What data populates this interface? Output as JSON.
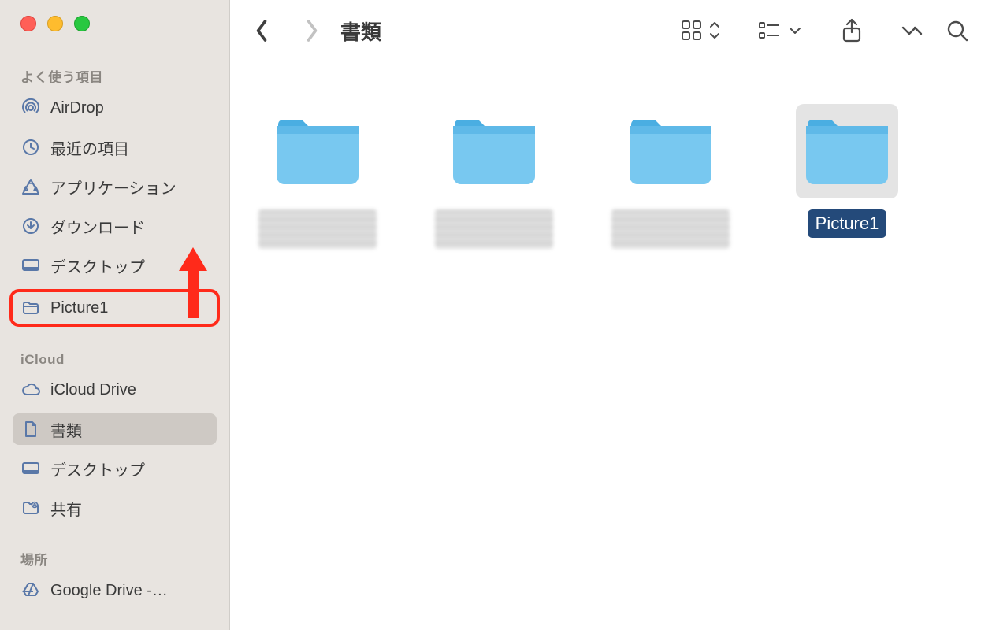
{
  "toolbar": {
    "title": "書類"
  },
  "sidebar": {
    "sections": [
      {
        "header": "よく使う項目",
        "items": [
          {
            "icon": "airdrop",
            "label": "AirDrop"
          },
          {
            "icon": "clock",
            "label": "最近の項目"
          },
          {
            "icon": "apps",
            "label": "アプリケーション"
          },
          {
            "icon": "download",
            "label": "ダウンロード"
          },
          {
            "icon": "desktop",
            "label": "デスクトップ"
          },
          {
            "icon": "folder",
            "label": "Picture1",
            "highlighted": true
          }
        ]
      },
      {
        "header": "iCloud",
        "items": [
          {
            "icon": "cloud",
            "label": "iCloud Drive"
          },
          {
            "icon": "document",
            "label": "書類",
            "active": true
          },
          {
            "icon": "desktop",
            "label": "デスクトップ"
          },
          {
            "icon": "shared",
            "label": "共有"
          }
        ]
      },
      {
        "header": "場所",
        "items": [
          {
            "icon": "drive",
            "label": "Google Drive -…"
          }
        ]
      }
    ]
  },
  "folders": [
    {
      "label": "",
      "blurred": true,
      "selected": false
    },
    {
      "label": "",
      "blurred": true,
      "selected": false
    },
    {
      "label": "",
      "blurred": true,
      "selected": false
    },
    {
      "label": "Picture1",
      "blurred": false,
      "selected": true
    }
  ],
  "colors": {
    "folderLight": "#78c8f0",
    "folderDark": "#4aaee2",
    "sidebarBg": "#e8e4e0",
    "accent": "#244a7a",
    "highlight": "#ff2a1a"
  }
}
